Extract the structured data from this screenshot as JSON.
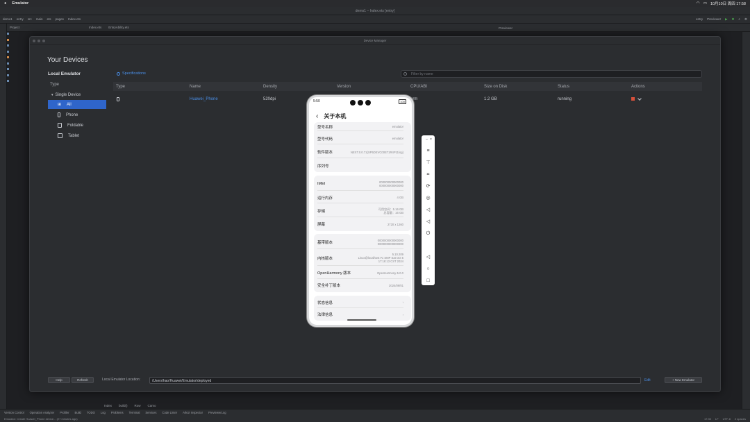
{
  "menubar": {
    "app": "Emulator",
    "datetime": "10月10日 周四 17:58"
  },
  "window_title": "demo1 – Index.ets [entry]",
  "crumbs": [
    "demo1",
    "entry",
    "src",
    "main",
    "ets",
    "pages",
    "Index.ets"
  ],
  "toolbar": {
    "module": "entry",
    "previewer": "Previewer"
  },
  "editor_tabs": [
    "Index.ets",
    "EntryAbility.ets"
  ],
  "project_panel": {
    "label": "Project"
  },
  "previewer_panel": {
    "label": "Previewer"
  },
  "device_manager": {
    "window_title": "Device Manager",
    "heading": "Your Devices",
    "section": "Local Emulator",
    "type_header": "Type",
    "group": "Single Device",
    "types": [
      "All",
      "Phone",
      "Foldable",
      "Tablet"
    ],
    "specs_link": "Specifications",
    "search_placeholder": "Filter by name",
    "columns": [
      "Type",
      "Name",
      "Density",
      "Version",
      "CPU/ABI",
      "Size on Disk",
      "Status",
      "Actions"
    ],
    "rows": [
      {
        "name": "Huawei_Phone",
        "density": "520dpi",
        "cpu": "arm",
        "size": "1.2 GB",
        "status": "running"
      }
    ],
    "help": "Help",
    "refresh": "Refresh",
    "location_label": "Local Emulator Location:",
    "location_value": "/Users/hao/Huawei/Emulator/deployed",
    "edit": "Edit",
    "new_emulator": "+ New Emulator"
  },
  "phone": {
    "time": "5:50",
    "battery": "100",
    "title": "关于本机",
    "rows": [
      {
        "label": "型号名称",
        "value": "emulator"
      },
      {
        "label": "型号代码",
        "value": "emulator"
      },
      {
        "label": "软件版本",
        "value": "NEXT.0.0.71(SP5DEVC00E71R4P11log)"
      },
      {
        "label": "序列号",
        "value": ""
      },
      {
        "label": "IMEI",
        "value": "000000000000000\n000000000000000"
      },
      {
        "label": "运行内存",
        "value": "4 GB"
      },
      {
        "label": "存储",
        "value": "可用空间：5.16 GB\n总容量：16 GB"
      },
      {
        "label": "屏幕",
        "value": "2720 x 1260"
      },
      {
        "label": "基带版本",
        "value": "0000000000000000\n0000000000000000"
      },
      {
        "label": "内核版本",
        "value": "5.10.209\nLinux@localhost #1 SMP Sat Oct 5\n17:18:13 CST 2024"
      },
      {
        "label": "OpenHarmony 版本",
        "value": "OpenHarmony-5.0.0"
      },
      {
        "label": "安全补丁版本",
        "value": "2024/09/01"
      },
      {
        "label": "状态信息",
        "value": ""
      },
      {
        "label": "法律信息",
        "value": ""
      }
    ]
  },
  "bottom_tabs": [
    "Index",
    "build()",
    "Row",
    "Camo"
  ],
  "tool_windows": [
    "Version Control",
    "Operation Analyzer",
    "Profiler",
    "Build",
    "TODO",
    "Log",
    "Problems",
    "Terminal",
    "Services",
    "Code Linter",
    "ArkUI Inspector",
    "PreviewerLog"
  ],
  "status": {
    "left": "Emulator: Create Huawei_Phone device... (27 minutes ago)",
    "right": [
      "17:30",
      "LF",
      "UTF-8",
      "2 spaces"
    ]
  },
  "colors": {
    "accent": "#2f65ca",
    "link": "#4a8fe8",
    "stop": "#d6503b"
  }
}
